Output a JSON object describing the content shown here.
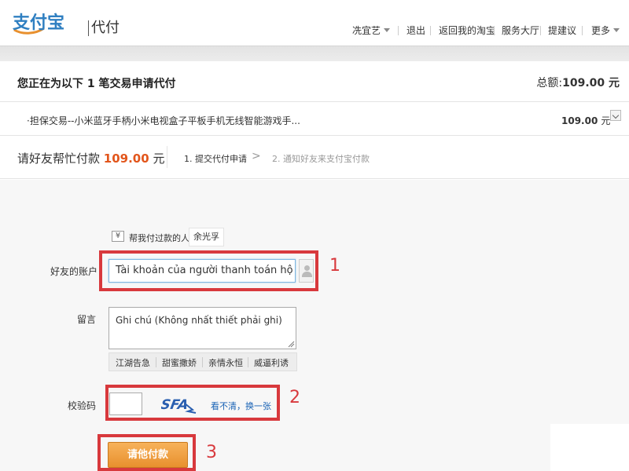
{
  "header": {
    "logo_text": "支付宝",
    "product": "代付",
    "nav": {
      "user": "冼宜艺",
      "logout": "退出",
      "back_taobao": "返回我的淘宝",
      "service_hall": "服务大厅",
      "feedback": "提建议",
      "more": "更多"
    }
  },
  "summary": {
    "title": "您正在为以下 1 笔交易申请代付",
    "total_label": "总额:",
    "total_value": "109.00 元"
  },
  "item": {
    "name": "·担保交易--小米蓝牙手柄小米电视盒子平板手机无线智能游戏手...",
    "price": "109.00",
    "unit": "元"
  },
  "steps": {
    "title_prefix": "请好友帮忙付款",
    "amount": "109.00",
    "currency": "元",
    "step1": "1. 提交代付申请",
    "arrow": ">",
    "step2": "2. 通知好友来支付宝付款"
  },
  "form": {
    "helper_label": "帮我付过款的人:",
    "helper_name": "余光孚",
    "account_label": "好友的账户",
    "account_value": "Tài khoản của người thanh toán hộ",
    "note_label": "留言",
    "note_value": "Ghi chú (Không nhất thiết phải ghi)",
    "quick_notes": [
      "江湖告急",
      "甜蜜撒娇",
      "亲情永恒",
      "威逼利诱"
    ],
    "captcha_label": "校验码",
    "captcha_text": "SFA",
    "captcha_refresh": "看不清，换一张",
    "submit": "请他付款"
  },
  "annotations": [
    "1",
    "2",
    "3"
  ],
  "colors": {
    "accent_orange": "#e8902e",
    "amount_red": "#e2561c",
    "annotation_red": "#d8393d",
    "link_blue": "#1862b5"
  }
}
